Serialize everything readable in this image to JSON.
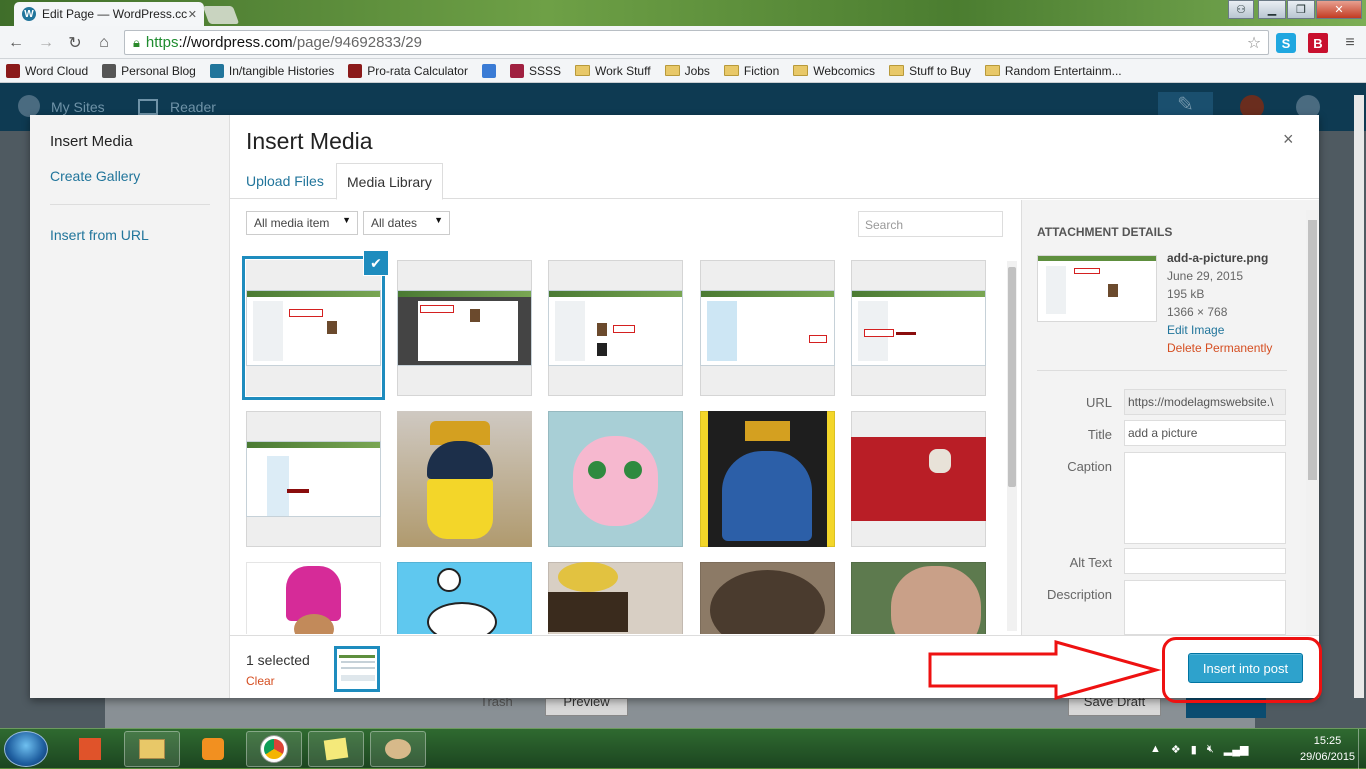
{
  "browser": {
    "tab_title": "Edit Page — WordPress.cc",
    "url_https": "https",
    "url_host": "://wordpress.com",
    "url_path": "/page/94692833/29"
  },
  "bookmarks": [
    {
      "label": "Word Cloud",
      "icon": "wordcloud-icon",
      "color": "#8b1a1a"
    },
    {
      "label": "Personal Blog",
      "icon": "blog-icon",
      "color": "#555"
    },
    {
      "label": "In/tangible Histories",
      "icon": "wordpress-icon",
      "color": "#21759b"
    },
    {
      "label": "Pro-rata Calculator",
      "icon": "calculator-icon",
      "color": "#8b1a1a"
    },
    {
      "label": "",
      "icon": "google-icon",
      "color": "#3a7bd5"
    },
    {
      "label": "SSSS",
      "icon": "ssss-icon",
      "color": "#a02040"
    },
    {
      "label": "Work Stuff",
      "icon": "folder-icon",
      "color": "#e8c868"
    },
    {
      "label": "Jobs",
      "icon": "folder-icon",
      "color": "#e8c868"
    },
    {
      "label": "Fiction",
      "icon": "folder-icon",
      "color": "#e8c868"
    },
    {
      "label": "Webcomics",
      "icon": "folder-icon",
      "color": "#e8c868"
    },
    {
      "label": "Stuff to Buy",
      "icon": "folder-icon",
      "color": "#e8c868"
    },
    {
      "label": "Random Entertainm...",
      "icon": "folder-icon",
      "color": "#e8c868"
    }
  ],
  "wpbar": {
    "my_sites": "My Sites",
    "reader": "Reader"
  },
  "modal": {
    "menu_title": "Insert Media",
    "create_gallery": "Create Gallery",
    "insert_from_url": "Insert from URL",
    "title": "Insert Media",
    "close": "×",
    "tab_upload": "Upload Files",
    "tab_library": "Media Library",
    "filter_type": "All media item",
    "filter_date": "All dates",
    "search_placeholder": "Search"
  },
  "attachment": {
    "heading": "ATTACHMENT DETAILS",
    "filename": "add-a-picture.png",
    "date": "June 29, 2015",
    "size": "195 kB",
    "dimensions": "1366 × 768",
    "edit": "Edit Image",
    "delete": "Delete Permanently",
    "url_label": "URL",
    "url_value": "https://modelagmswebsite.\\",
    "title_label": "Title",
    "title_value": "add a picture",
    "caption_label": "Caption",
    "alt_label": "Alt Text",
    "description_label": "Description"
  },
  "footer": {
    "selected": "1 selected",
    "clear": "Clear",
    "insert": "Insert into post"
  },
  "behind": {
    "trash": "Trash",
    "preview": "Preview",
    "save_draft": "Save Draft"
  },
  "clock": {
    "time": "15:25",
    "date": "29/06/2015"
  },
  "colors": {
    "accent": "#1e8cbe",
    "button": "#2ea2cc",
    "danger": "#d54e21",
    "annotation": "#e11111"
  }
}
